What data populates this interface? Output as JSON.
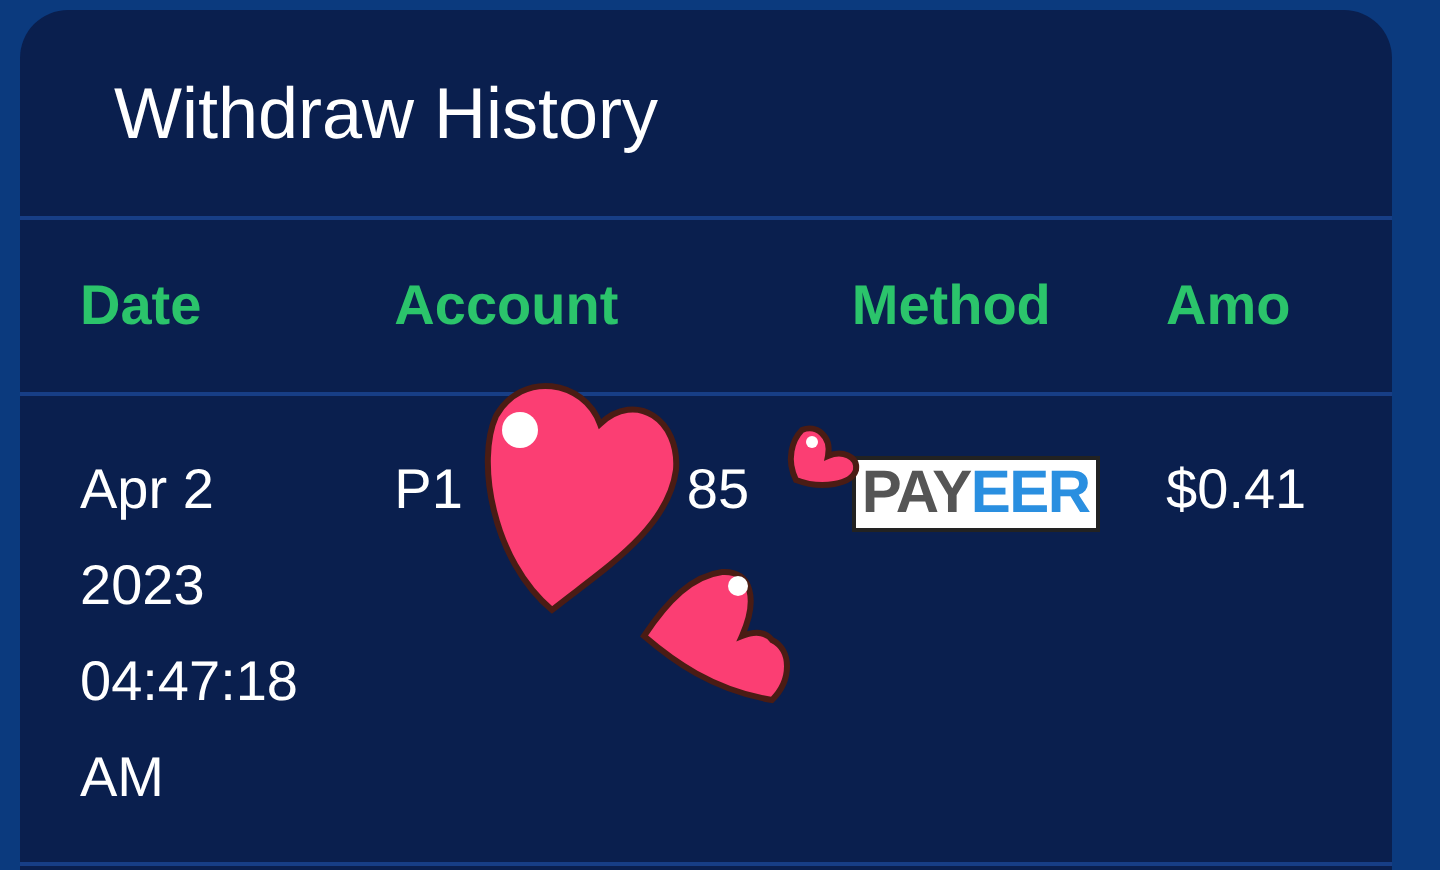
{
  "card": {
    "title": "Withdraw History"
  },
  "table": {
    "columns": [
      "Date",
      "Account",
      "Method",
      "Amo"
    ],
    "rows": [
      {
        "date": [
          "Apr 2",
          "2023",
          "04:47:18",
          "AM"
        ],
        "account": [
          "P1",
          "85"
        ],
        "method": {
          "kind": "logo",
          "parts": [
            "PAY",
            "EER"
          ]
        },
        "amount": "$0.41"
      }
    ]
  }
}
